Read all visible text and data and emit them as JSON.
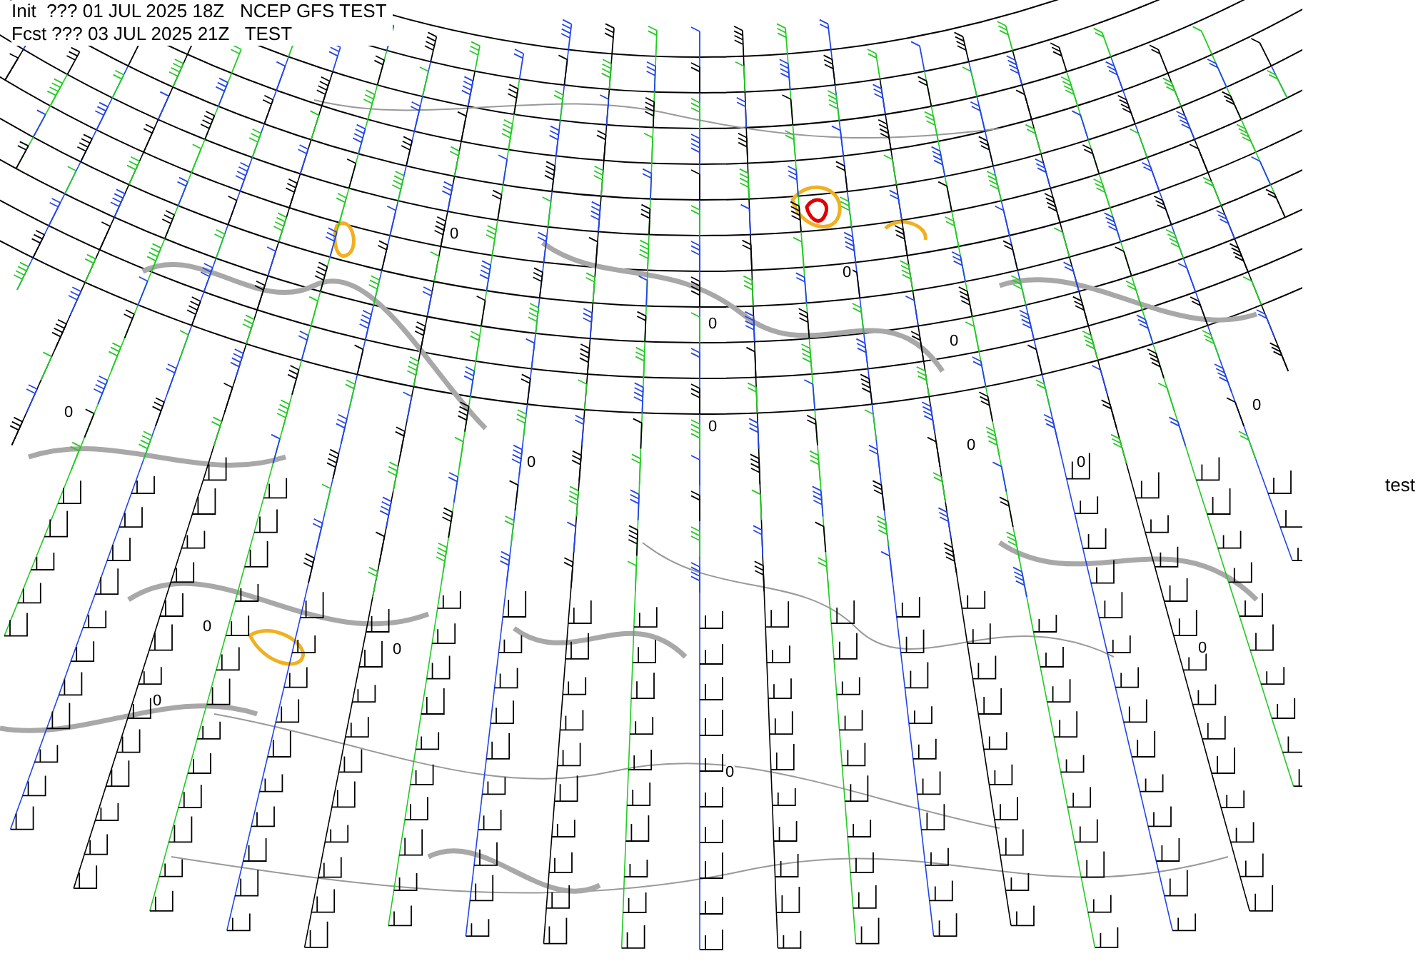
{
  "header": {
    "init_line": "Init  ??? 01 JUL 2025 18Z   NCEP GFS TEST",
    "forecast_line": "Fcst ??? 03 JUL 2025 21Z   TEST"
  },
  "contour_labels": [
    "0",
    "0",
    "0",
    "0",
    "0",
    "0",
    "0",
    "0",
    "0",
    "0",
    "0",
    "0",
    "0",
    "0",
    "0"
  ],
  "side_label": "test"
}
